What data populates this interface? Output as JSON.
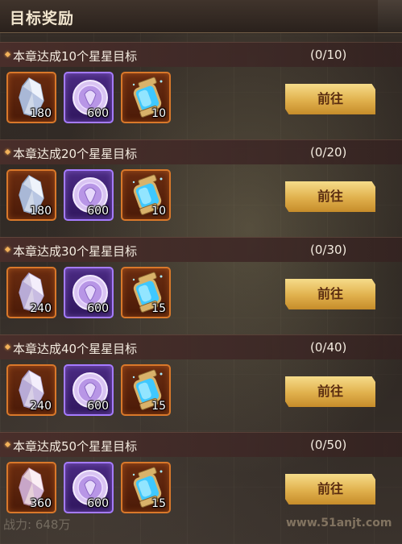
{
  "header": {
    "title": "目标奖励"
  },
  "goals": [
    {
      "label": "本章达成10个星星目标",
      "progress": "(0/10)",
      "button": "前往",
      "rewards": [
        {
          "icon": "crystal-icon",
          "count": "180"
        },
        {
          "icon": "coin-icon",
          "count": "600"
        },
        {
          "icon": "lantern-icon",
          "count": "10"
        }
      ]
    },
    {
      "label": "本章达成20个星星目标",
      "progress": "(0/20)",
      "button": "前往",
      "rewards": [
        {
          "icon": "crystal-icon",
          "count": "180"
        },
        {
          "icon": "coin-icon",
          "count": "600"
        },
        {
          "icon": "lantern-icon",
          "count": "10"
        }
      ]
    },
    {
      "label": "本章达成30个星星目标",
      "progress": "(0/30)",
      "button": "前往",
      "rewards": [
        {
          "icon": "crystal-icon",
          "count": "240"
        },
        {
          "icon": "coin-icon",
          "count": "600"
        },
        {
          "icon": "lantern-icon",
          "count": "15"
        }
      ]
    },
    {
      "label": "本章达成40个星星目标",
      "progress": "(0/40)",
      "button": "前往",
      "rewards": [
        {
          "icon": "crystal-icon",
          "count": "240"
        },
        {
          "icon": "coin-icon",
          "count": "600"
        },
        {
          "icon": "lantern-icon",
          "count": "15"
        }
      ]
    },
    {
      "label": "本章达成50个星星目标",
      "progress": "(0/50)",
      "button": "前往",
      "rewards": [
        {
          "icon": "crystal-icon",
          "count": "360"
        },
        {
          "icon": "coin-icon",
          "count": "600"
        },
        {
          "icon": "lantern-icon",
          "count": "15"
        }
      ]
    }
  ],
  "background": {
    "bottom_text": "战力: 648万"
  },
  "watermark": "www.51anjt.com",
  "colors": {
    "button": "#e0b04c",
    "orange_frame": "#d9782a",
    "purple_frame": "#a57bff"
  }
}
